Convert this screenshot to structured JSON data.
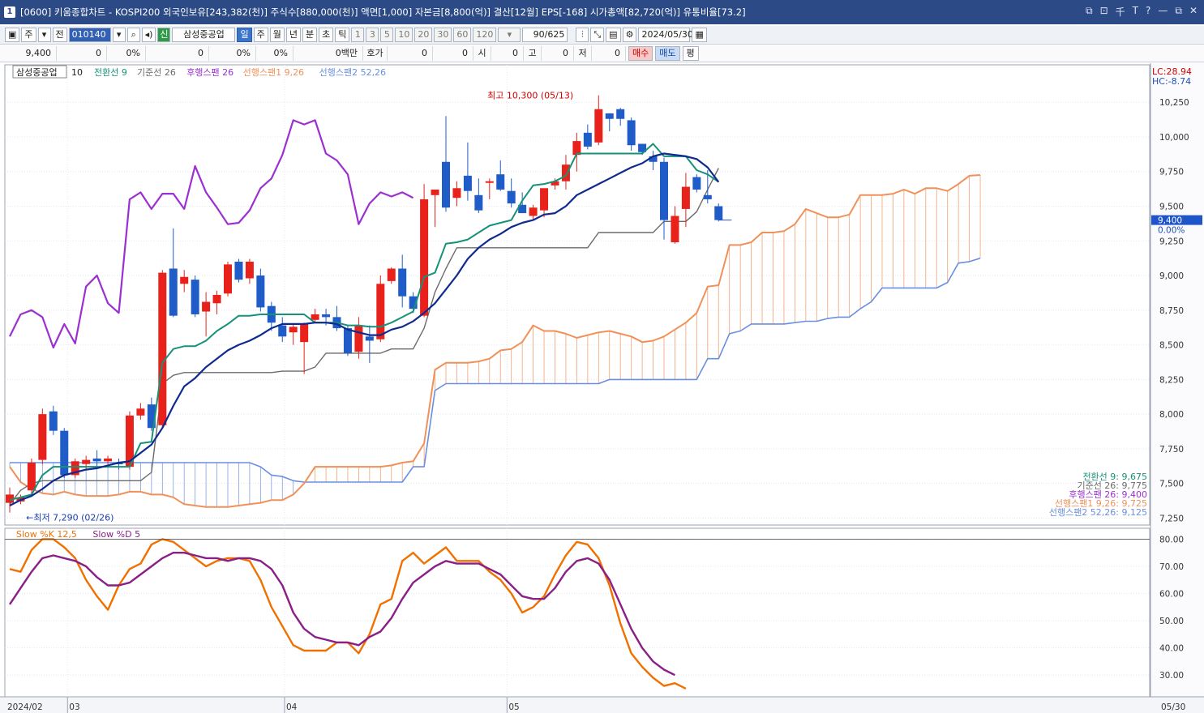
{
  "window": {
    "title_num": "1",
    "title": "[0600] 키움종합차트 - KOSPI200 외국인보유[243,382(천)] 주식수[880,000(천)] 액면[1,000] 자본금[8,800(억)] 결산[12월] EPS[-168] 시가총액[82,720(억)] 유통비율[73.2]",
    "buttons": [
      "⧉",
      "⊡",
      "千",
      "T",
      "?",
      "—",
      "⧉",
      "✕"
    ]
  },
  "toolbar": {
    "type_select": "주",
    "prefix": "전",
    "code": "010140",
    "stock_name": "삼성중공업",
    "period_tabs": [
      "일",
      "주",
      "월",
      "년",
      "분",
      "초",
      "틱"
    ],
    "active_period": "일",
    "minute_options": [
      "1",
      "3",
      "5",
      "10",
      "20",
      "30",
      "60",
      "120"
    ],
    "count_display": "90/625",
    "date": "2024/05/30"
  },
  "quote": {
    "price": "9,400",
    "change": "0",
    "change_pct": "0%",
    "volume": "0",
    "vol_pct": "0%",
    "vol_pct2": "0%",
    "amount": "0백만",
    "hoga_label": "호가",
    "hoga": "0",
    "hoga2": "0",
    "open_label": "시",
    "open": "0",
    "high_label": "고",
    "high": "0",
    "low_label": "저",
    "low": "0",
    "sell": "매수",
    "buy": "매도",
    "avg": "평"
  },
  "colors": {
    "up": "#e8221b",
    "down": "#1f5cc7",
    "conversion": "#16917a",
    "base": "#0f2a8e",
    "lagging": "#9b2fd1",
    "span1": "#f0915a",
    "span2": "#6a8fe0",
    "stoch_k": "#f07000",
    "stoch_d": "#8a1f86"
  },
  "chart_data": [
    {
      "type": "candlestick",
      "legend": {
        "stock": "삼성중공업",
        "period": "10",
        "items": [
          {
            "name": "전환선 9",
            "color": "#16917a"
          },
          {
            "name": "기준선 26",
            "color": "#6b6b6b"
          },
          {
            "name": "후행스팬 26",
            "color": "#9b2fd1"
          },
          {
            "name": "선행스팬1 9,26",
            "color": "#f0915a"
          },
          {
            "name": "선행스팬2 52,26",
            "color": "#6a8fe0"
          }
        ]
      },
      "lc": "LC:28.94",
      "hc": "HC:-8.74",
      "current_price_label": "9,400",
      "current_pct_label": "0.00%",
      "yticks": [
        10250,
        10000,
        9750,
        9500,
        9250,
        9000,
        8750,
        8500,
        8250,
        8000,
        7750,
        7500,
        7250
      ],
      "ytick_labels": [
        "10,250",
        "10,000",
        "9,750",
        "9,500",
        "9,250",
        "9,000",
        "8,750",
        "8,500",
        "8,250",
        "8,000",
        "7,750",
        "7,500",
        "7,250"
      ],
      "ylim": [
        7200,
        10520
      ],
      "x_labels": [
        {
          "label": "2024/02",
          "index": 0
        },
        {
          "label": "03",
          "index": 5.3
        },
        {
          "label": "04",
          "index": 25.2
        },
        {
          "label": "05",
          "index": 45.6
        }
      ],
      "x_end_label": "05/30",
      "high_marker": "최고 10,300 (05/13)",
      "low_marker": "←최저 7,290 (02/26)",
      "value_labels": [
        {
          "text": "전환선 9: 9,675",
          "color": "#16917a"
        },
        {
          "text": "기준선 26: 9,775",
          "color": "#6b6b6b"
        },
        {
          "text": "후행스팬 26: 9,400",
          "color": "#9b2fd1"
        },
        {
          "text": "선행스팬1 9,26: 9,725",
          "color": "#f0915a"
        },
        {
          "text": "선행스팬2 52,26: 9,125",
          "color": "#6a8fe0"
        }
      ],
      "candles": [
        [
          7360,
          7420,
          7290,
          7470
        ],
        [
          7370,
          7400,
          7350,
          7420
        ],
        [
          7450,
          7650,
          7420,
          7680
        ],
        [
          7670,
          8000,
          7640,
          8040
        ],
        [
          8020,
          7880,
          7850,
          8060
        ],
        [
          7880,
          7560,
          7540,
          7900
        ],
        [
          7560,
          7660,
          7540,
          7680
        ],
        [
          7640,
          7670,
          7600,
          7700
        ],
        [
          7680,
          7660,
          7620,
          7740
        ],
        [
          7660,
          7680,
          7640,
          7700
        ],
        [
          7650,
          7640,
          7600,
          7680
        ],
        [
          7620,
          7990,
          7600,
          8020
        ],
        [
          7990,
          8040,
          7960,
          8080
        ],
        [
          8070,
          7900,
          7880,
          8120
        ],
        [
          7920,
          9020,
          7900,
          9040
        ],
        [
          9050,
          8710,
          8700,
          9340
        ],
        [
          8940,
          8990,
          8880,
          9040
        ],
        [
          8970,
          8720,
          8700,
          9000
        ],
        [
          8740,
          8810,
          8560,
          8880
        ],
        [
          8800,
          8860,
          8720,
          8890
        ],
        [
          8870,
          9080,
          8850,
          9100
        ],
        [
          9100,
          8970,
          8950,
          9120
        ],
        [
          8980,
          9100,
          8940,
          9120
        ],
        [
          9000,
          8770,
          8740,
          9050
        ],
        [
          8780,
          8660,
          8600,
          8810
        ],
        [
          8640,
          8560,
          8520,
          8700
        ],
        [
          8590,
          8630,
          8500,
          8650
        ],
        [
          8520,
          8650,
          8290,
          8660
        ],
        [
          8680,
          8720,
          8660,
          8760
        ],
        [
          8720,
          8700,
          8640,
          8760
        ],
        [
          8700,
          8620,
          8600,
          8780
        ],
        [
          8620,
          8440,
          8420,
          8640
        ],
        [
          8450,
          8640,
          8400,
          8700
        ],
        [
          8560,
          8530,
          8370,
          8640
        ],
        [
          8540,
          8940,
          8520,
          9000
        ],
        [
          8960,
          9050,
          8940,
          9060
        ],
        [
          9050,
          8850,
          8770,
          9150
        ],
        [
          8850,
          8760,
          8730,
          8880
        ],
        [
          8710,
          9550,
          8700,
          9660
        ],
        [
          9580,
          9620,
          9350,
          9600
        ],
        [
          9820,
          9490,
          9460,
          10150
        ],
        [
          9560,
          9630,
          9500,
          9680
        ],
        [
          9720,
          9610,
          9540,
          9960
        ],
        [
          9580,
          9470,
          9450,
          9700
        ],
        [
          9670,
          9680,
          9550,
          9700
        ],
        [
          9730,
          9620,
          9610,
          9830
        ],
        [
          9610,
          9520,
          9490,
          9700
        ],
        [
          9510,
          9450,
          9450,
          9600
        ],
        [
          9430,
          9490,
          9400,
          9510
        ],
        [
          9470,
          9630,
          9420,
          9620
        ],
        [
          9650,
          9680,
          9620,
          9700
        ],
        [
          9680,
          9800,
          9620,
          9870
        ],
        [
          9870,
          9970,
          9750,
          10030
        ],
        [
          10030,
          9930,
          9910,
          10090
        ],
        [
          9960,
          10200,
          9940,
          10300
        ],
        [
          10170,
          10130,
          10040,
          10170
        ],
        [
          10200,
          10130,
          10080,
          10210
        ],
        [
          10120,
          9940,
          9900,
          10140
        ],
        [
          9950,
          9890,
          9870,
          9950
        ],
        [
          9860,
          9820,
          9760,
          9900
        ],
        [
          9820,
          9400,
          9260,
          9850
        ],
        [
          9240,
          9430,
          9230,
          9500
        ],
        [
          9480,
          9640,
          9350,
          9740
        ],
        [
          9710,
          9620,
          9600,
          9730
        ],
        [
          9580,
          9550,
          9520,
          9760
        ],
        [
          9500,
          9400,
          9390,
          9520
        ]
      ],
      "conversion_line": [
        7380,
        7400,
        7420,
        7560,
        7620,
        7620,
        7620,
        7620,
        7620,
        7620,
        7620,
        7620,
        7790,
        7800,
        8370,
        8470,
        8490,
        8490,
        8530,
        8600,
        8650,
        8710,
        8710,
        8720,
        8720,
        8720,
        8720,
        8720,
        8660,
        8660,
        8660,
        8640,
        8640,
        8630,
        8630,
        8660,
        8700,
        8740,
        8990,
        9020,
        9230,
        9240,
        9260,
        9310,
        9360,
        9380,
        9400,
        9540,
        9650,
        9660,
        9680,
        9720,
        9880,
        9880,
        9880,
        9880,
        9880,
        9880,
        9880,
        9950,
        9860,
        9860,
        9860,
        9760,
        9730,
        9675
      ],
      "base_line": [
        7340,
        7380,
        7410,
        7460,
        7520,
        7560,
        7580,
        7600,
        7610,
        7630,
        7650,
        7660,
        7720,
        7780,
        7900,
        8060,
        8200,
        8260,
        8340,
        8400,
        8460,
        8500,
        8530,
        8570,
        8620,
        8650,
        8650,
        8650,
        8660,
        8660,
        8650,
        8610,
        8590,
        8570,
        8570,
        8610,
        8630,
        8670,
        8730,
        8800,
        8900,
        9000,
        9120,
        9200,
        9260,
        9300,
        9350,
        9380,
        9400,
        9440,
        9450,
        9500,
        9580,
        9620,
        9660,
        9700,
        9740,
        9780,
        9810,
        9860,
        9880,
        9870,
        9860,
        9840,
        9780,
        9675
      ],
      "kijun_line": [
        7350,
        7450,
        7500,
        7520,
        7520,
        7520,
        7520,
        7520,
        7520,
        7520,
        7520,
        7520,
        7520,
        7580,
        8220,
        8280,
        8300,
        8300,
        8300,
        8300,
        8300,
        8300,
        8300,
        8300,
        8300,
        8310,
        8310,
        8310,
        8340,
        8440,
        8440,
        8440,
        8440,
        8440,
        8440,
        8470,
        8470,
        8470,
        8620,
        8880,
        9050,
        9200,
        9200,
        9200,
        9200,
        9200,
        9200,
        9200,
        9200,
        9200,
        9200,
        9200,
        9200,
        9200,
        9310,
        9310,
        9310,
        9310,
        9310,
        9310,
        9390,
        9390,
        9390,
        9460,
        9620,
        9775
      ],
      "lagging_span": [
        8560,
        8720,
        8750,
        8700,
        8480,
        8650,
        8510,
        8920,
        9000,
        8800,
        8730,
        9550,
        9600,
        9480,
        9590,
        9590,
        9480,
        9790,
        9600,
        9490,
        9370,
        9380,
        9470,
        9630,
        9700,
        9870,
        10120,
        10090,
        10120,
        9880,
        9830,
        9730,
        9370,
        9520,
        9600,
        9570,
        9600,
        9560
      ],
      "span1": [
        7620,
        7510,
        7460,
        7430,
        7420,
        7440,
        7420,
        7410,
        7410,
        7410,
        7420,
        7440,
        7440,
        7420,
        7420,
        7400,
        7350,
        7340,
        7330,
        7330,
        7330,
        7340,
        7350,
        7360,
        7380,
        7380,
        7420,
        7500,
        7620,
        7620,
        7620,
        7620,
        7620,
        7620,
        7620,
        7630,
        7650,
        7660,
        7790,
        8320,
        8370,
        8370,
        8370,
        8380,
        8400,
        8460,
        8470,
        8520,
        8640,
        8600,
        8600,
        8580,
        8550,
        8570,
        8590,
        8600,
        8580,
        8560,
        8520,
        8530,
        8560,
        8610,
        8660,
        8730,
        8920,
        8930,
        9220,
        9220,
        9240,
        9310,
        9310,
        9320,
        9370,
        9480,
        9450,
        9420,
        9420,
        9440,
        9580,
        9580,
        9580,
        9590,
        9620,
        9590,
        9630,
        9630,
        9610,
        9660,
        9720,
        9725
      ],
      "span2": [
        7650,
        7650,
        7650,
        7650,
        7650,
        7650,
        7650,
        7650,
        7650,
        7650,
        7650,
        7650,
        7650,
        7650,
        7650,
        7650,
        7650,
        7650,
        7650,
        7650,
        7650,
        7650,
        7650,
        7620,
        7560,
        7550,
        7520,
        7510,
        7510,
        7510,
        7510,
        7510,
        7510,
        7510,
        7510,
        7510,
        7510,
        7620,
        7620,
        8170,
        8220,
        8220,
        8220,
        8220,
        8220,
        8220,
        8220,
        8220,
        8220,
        8220,
        8220,
        8220,
        8220,
        8220,
        8220,
        8250,
        8250,
        8250,
        8250,
        8250,
        8250,
        8250,
        8250,
        8250,
        8400,
        8400,
        8580,
        8600,
        8650,
        8650,
        8650,
        8650,
        8660,
        8670,
        8670,
        8690,
        8700,
        8700,
        8760,
        8810,
        8910,
        8910,
        8910,
        8910,
        8910,
        8910,
        8950,
        9090,
        9100,
        9125
      ]
    },
    {
      "type": "line",
      "legend": [
        {
          "name": "Slow %K 12,5",
          "color": "#f07000"
        },
        {
          "name": "Slow %D 5",
          "color": "#8a1f86"
        }
      ],
      "yticks": [
        80,
        70,
        60,
        50,
        40,
        30
      ],
      "ytick_labels": [
        "80.00",
        "70.00",
        "60.00",
        "50.00",
        "40.00",
        "30.00"
      ],
      "ylim": [
        22,
        84
      ],
      "series": [
        {
          "name": "Slow %K 12,5",
          "values": [
            69,
            68,
            76,
            80,
            80,
            77,
            73,
            65,
            59,
            54,
            63,
            69,
            71,
            78,
            80,
            79,
            76,
            73,
            70,
            72,
            73,
            73,
            72,
            65,
            55,
            48,
            41,
            39,
            39,
            39,
            42,
            42,
            38,
            45,
            56,
            58,
            72,
            75,
            71,
            74,
            77,
            72,
            72,
            72,
            68,
            65,
            60,
            53,
            55,
            59,
            67,
            74,
            79,
            78,
            73,
            63,
            49,
            38,
            33,
            29,
            26,
            27,
            25
          ]
        },
        {
          "name": "Slow %D 5",
          "values": [
            56,
            62,
            68,
            73,
            74,
            73,
            72,
            70,
            66,
            63,
            63,
            64,
            67,
            70,
            73,
            75,
            75,
            74,
            73,
            73,
            72,
            73,
            73,
            72,
            69,
            63,
            53,
            47,
            44,
            43,
            42,
            42,
            41,
            44,
            46,
            51,
            58,
            64,
            67,
            70,
            72,
            71,
            71,
            71,
            69,
            67,
            63,
            59,
            58,
            58,
            62,
            68,
            72,
            73,
            71,
            65,
            56,
            47,
            40,
            35,
            32,
            30
          ]
        }
      ]
    }
  ]
}
